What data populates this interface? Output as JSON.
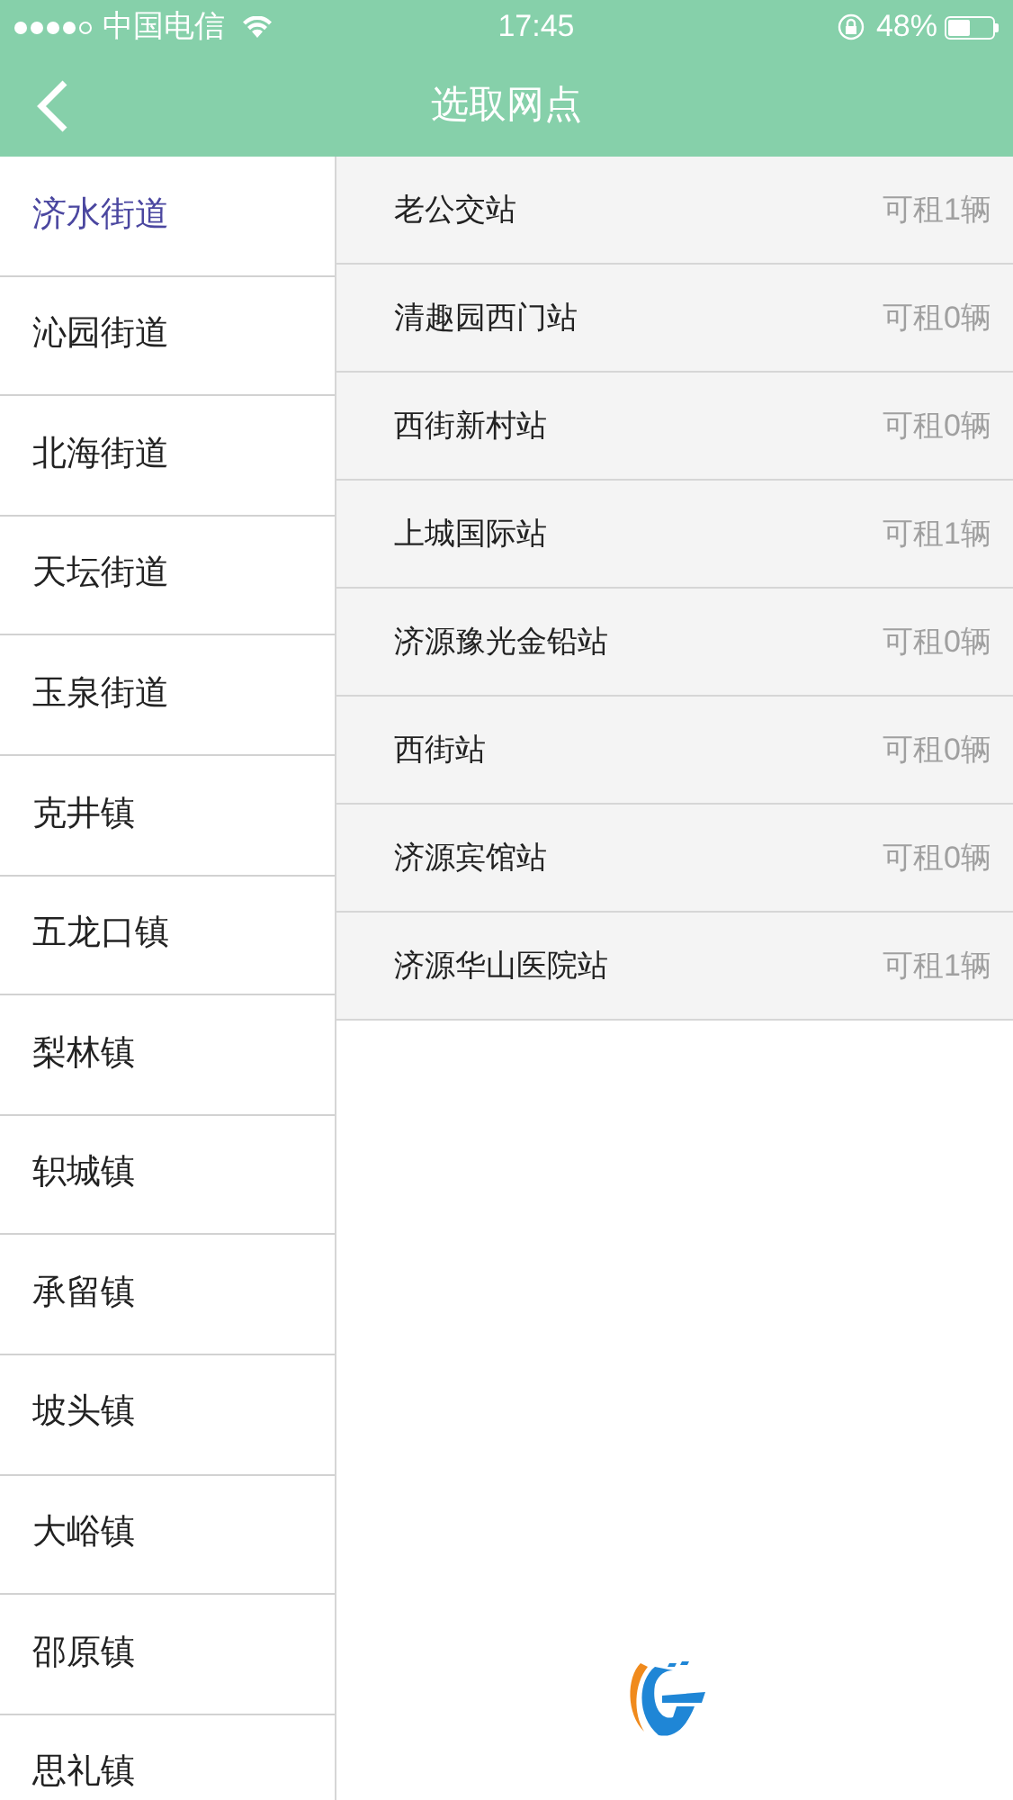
{
  "status_bar": {
    "signal_dots": [
      {
        "on": true
      },
      {
        "on": true
      },
      {
        "on": true
      },
      {
        "on": true
      },
      {
        "on": false
      }
    ],
    "carrier": "中国电信",
    "time": "17:45",
    "battery_text": "48%",
    "battery": {
      "level": 0.48
    }
  },
  "header": {
    "title": "选取网点"
  },
  "districts": [
    {
      "name": "济水街道",
      "selected": true
    },
    {
      "name": "沁园街道",
      "selected": false
    },
    {
      "name": "北海街道",
      "selected": false
    },
    {
      "name": "天坛街道",
      "selected": false
    },
    {
      "name": "玉泉街道",
      "selected": false
    },
    {
      "name": "克井镇",
      "selected": false
    },
    {
      "name": "五龙口镇",
      "selected": false
    },
    {
      "name": "梨林镇",
      "selected": false
    },
    {
      "name": "轵城镇",
      "selected": false
    },
    {
      "name": "承留镇",
      "selected": false
    },
    {
      "name": "坡头镇",
      "selected": false
    },
    {
      "name": "大峪镇",
      "selected": false
    },
    {
      "name": "邵原镇",
      "selected": false
    },
    {
      "name": "思礼镇",
      "selected": false
    }
  ],
  "stations": [
    {
      "name": "老公交站",
      "availability": "可租1辆"
    },
    {
      "name": "清趣园西门站",
      "availability": "可租0辆"
    },
    {
      "name": "西街新村站",
      "availability": "可租0辆"
    },
    {
      "name": "上城国际站",
      "availability": "可租1辆"
    },
    {
      "name": "济源豫光金铅站",
      "availability": "可租0辆"
    },
    {
      "name": "西街站",
      "availability": "可租0辆"
    },
    {
      "name": "济源宾馆站",
      "availability": "可租0辆"
    },
    {
      "name": "济源华山医院站",
      "availability": "可租1辆"
    }
  ]
}
